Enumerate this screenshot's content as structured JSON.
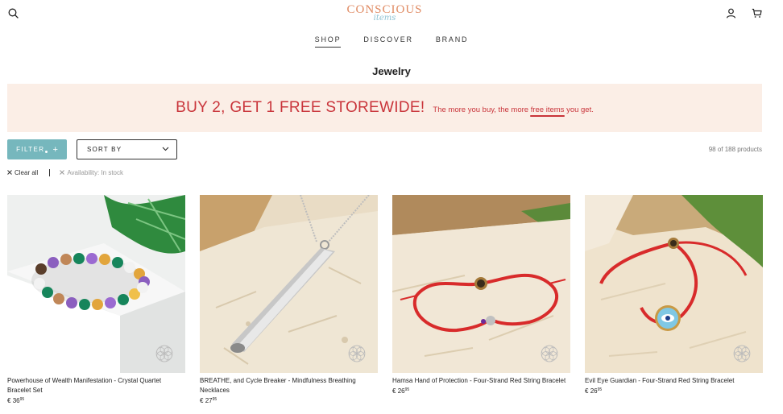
{
  "header": {
    "logo_main": "CONSCIOUS",
    "logo_sub": "items"
  },
  "nav": [
    {
      "label": "SHOP"
    },
    {
      "label": "DISCOVER"
    },
    {
      "label": "BRAND"
    }
  ],
  "page_title": "Jewelry",
  "promo": {
    "headline": "BUY 2, GET 1 FREE STOREWIDE!",
    "sub_before": "The more you buy, the more",
    "sub_highlight": "free items",
    "sub_after": "you get."
  },
  "toolbar": {
    "filter_label": "FILTER",
    "filter_plus": "+",
    "sort_label": "SORT BY",
    "count": "98 of 188 products"
  },
  "filters": {
    "clear_all": "Clear all",
    "active": "Availability: In stock"
  },
  "products": [
    {
      "name": "Powerhouse of Wealth Manifestation - Crystal Quartet Bracelet Set",
      "price_main": "36",
      "price_cents": "95",
      "currency": "€"
    },
    {
      "name": "BREATHE, and Cycle Breaker - Mindfulness Breathing Necklaces",
      "price_main": "27",
      "price_cents": "95",
      "currency": "€"
    },
    {
      "name": "Hamsa Hand of Protection - Four-Strand Red String Bracelet",
      "price_main": "26",
      "price_cents": "95",
      "currency": "€"
    },
    {
      "name": "Evil Eye Guardian - Four-Strand Red String Bracelet",
      "price_main": "26",
      "price_cents": "95",
      "currency": "€"
    }
  ],
  "colors": {
    "promo_red": "#c9343a",
    "promo_bg": "#fbeee6",
    "filter_teal": "#76b7bd",
    "logo_orange": "#e08a62"
  }
}
